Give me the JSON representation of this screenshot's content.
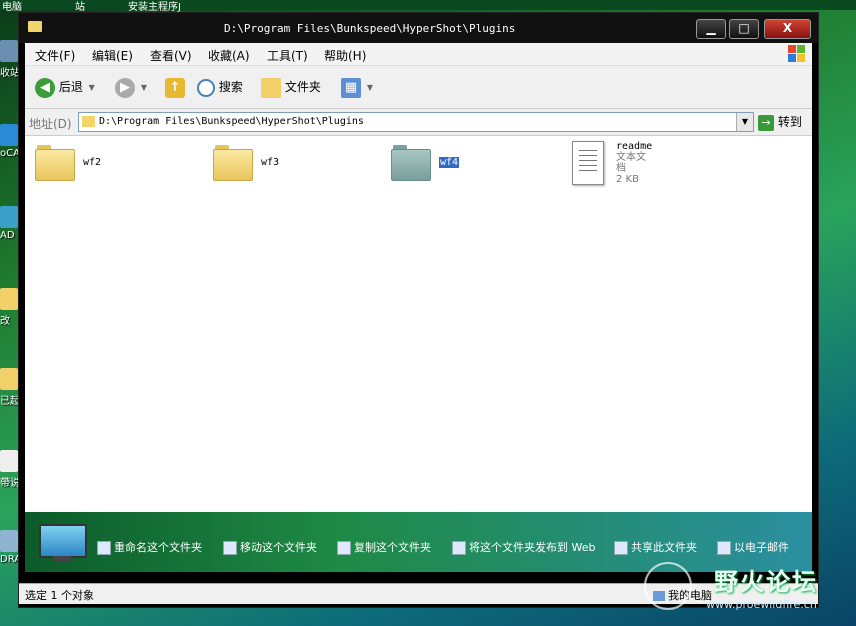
{
  "window": {
    "title": "D:\\Program Files\\Bunkspeed\\HyperShot\\Plugins",
    "buttons": {
      "minimize": "▁",
      "maximize": "□",
      "close": "X"
    }
  },
  "menu": [
    "文件(F)",
    "编辑(E)",
    "查看(V)",
    "收藏(A)",
    "工具(T)",
    "帮助(H)"
  ],
  "toolbar": {
    "back": "后退",
    "search": "搜索",
    "folders": "文件夹"
  },
  "address": {
    "label": "地址(D)",
    "path": "D:\\Program Files\\Bunkspeed\\HyperShot\\Plugins",
    "go": "转到"
  },
  "items": [
    {
      "name": "wf2",
      "type": "folder",
      "selected": false
    },
    {
      "name": "wf3",
      "type": "folder",
      "selected": false
    },
    {
      "name": "wf4",
      "type": "folder",
      "selected": true
    },
    {
      "name": "readme",
      "type": "document",
      "kind": "文本文档",
      "size": "2 KB"
    }
  ],
  "tasks": [
    "重命名这个文件夹",
    "移动这个文件夹",
    "复制这个文件夹",
    "将这个文件夹发布到 Web",
    "共享此文件夹",
    "以电子邮件"
  ],
  "status": {
    "left": "选定 1 个对象",
    "right": "我的电脑"
  },
  "desktop": {
    "top_labels": [
      "电脑",
      "站",
      "安装主程序J"
    ],
    "icons": [
      "收站",
      "oCA",
      "AD",
      "改",
      "已起",
      "帶说",
      "DRAV"
    ]
  },
  "watermark": {
    "title": "野火论坛",
    "url": "www.proewildfire.cn"
  }
}
